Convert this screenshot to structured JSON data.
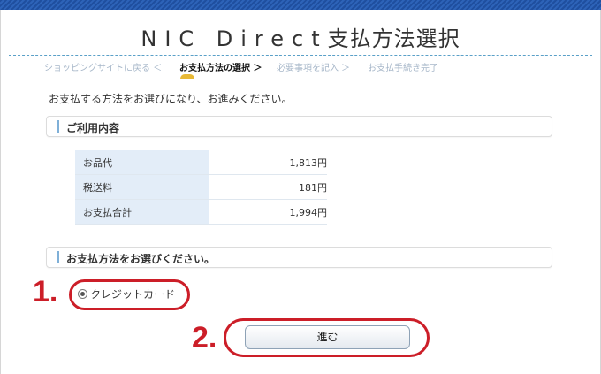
{
  "header": {
    "title_latin": "NIC Direct",
    "title_jp": "支払方法選択"
  },
  "steps": {
    "items": [
      "ショッピングサイトに戻る ＜",
      "お支払方法の選択 ＞",
      "必要事項を記入 ＞",
      "お支払手続き完了"
    ],
    "active_index": 1
  },
  "intro": "お支払する方法をお選びになり、お進みください。",
  "usage": {
    "heading": "ご利用内容",
    "rows": [
      {
        "label": "お品代",
        "value": "1,813円"
      },
      {
        "label": "税送料",
        "value": "181円"
      },
      {
        "label": "お支払合計",
        "value": "1,994円"
      }
    ]
  },
  "payment": {
    "heading": "お支払方法をお選びください。",
    "option_label": "クレジットカード",
    "selected": true
  },
  "proceed_label": "進む",
  "annotations": {
    "step1": "1.",
    "step2": "2."
  },
  "colors": {
    "top_bar": "#1f4f9f",
    "annotation": "#cc1e28",
    "table_key_bg": "#e3edf8"
  }
}
